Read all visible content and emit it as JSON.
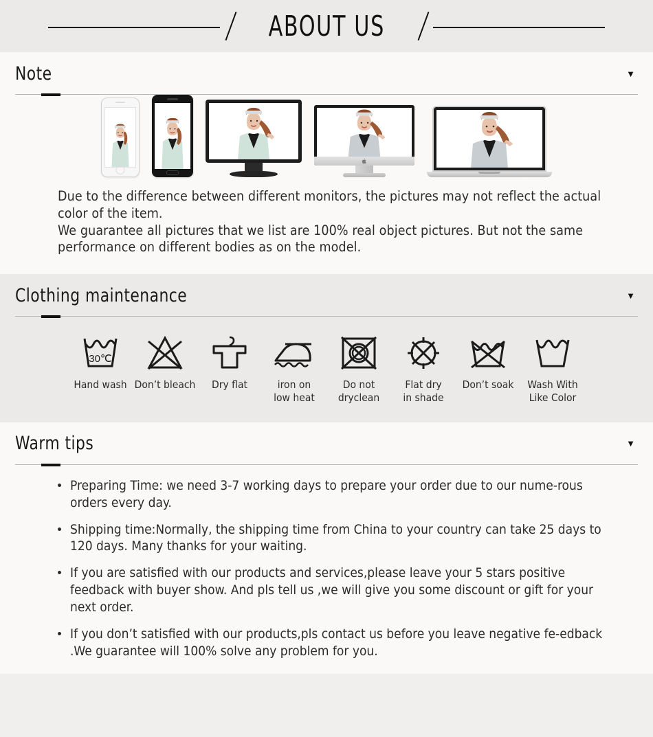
{
  "banner": {
    "title": "ABOUT US"
  },
  "sections": [
    {
      "id": "note",
      "title": "Note",
      "caret": "▼",
      "caret_icon_name": "chevron-down-icon",
      "devices": [
        {
          "name": "iphone-mockup",
          "tone": "mint"
        },
        {
          "name": "android-phone-mockup",
          "tone": "mint"
        },
        {
          "name": "desktop-monitor-mockup",
          "tone": "mint"
        },
        {
          "name": "imac-mockup",
          "tone": "gray"
        },
        {
          "name": "laptop-mockup",
          "tone": "gray"
        }
      ],
      "paragraphs": [
        "Due to the difference between different monitors, the pictures may not reflect the actual color of the item.",
        "We guarantee all pictures that we list are 100% real object pictures. But not the same performance on different bodies as on the model."
      ]
    },
    {
      "id": "clothing-maintenance",
      "title": "Clothing maintenance",
      "caret": "▼",
      "caret_icon_name": "chevron-down-icon",
      "care_items": [
        {
          "icon": "hand-wash-icon",
          "label": "Hand wash",
          "temperature": "30℃"
        },
        {
          "icon": "do-not-bleach-icon",
          "label": "Don’t bleach",
          "temperature": ""
        },
        {
          "icon": "dry-flat-icon",
          "label": "Dry flat",
          "temperature": ""
        },
        {
          "icon": "iron-low-heat-icon",
          "label": "iron on\nlow heat",
          "temperature": ""
        },
        {
          "icon": "do-not-dryclean-icon",
          "label": "Do not\ndryclean",
          "temperature": ""
        },
        {
          "icon": "flat-dry-shade-icon",
          "label": "Flat dry\nin shade",
          "temperature": ""
        },
        {
          "icon": "do-not-soak-icon",
          "label": "Don’t soak",
          "temperature": ""
        },
        {
          "icon": "wash-like-color-icon",
          "label": "Wash With\nLike Color",
          "temperature": ""
        }
      ]
    },
    {
      "id": "warm-tips",
      "title": "Warm tips",
      "caret": "▼",
      "caret_icon_name": "chevron-down-icon",
      "tips": [
        "Preparing Time: we need 3-7 working days to prepare your order due to our nume-rous orders every day.",
        "Shipping time:Normally, the shipping time from China to your country can take 25 days to 120 days. Many thanks for your waiting.",
        "If you are satisfied with our products and services,please leave your 5 stars positive feedback with buyer show. And pls tell us ,we will give you some discount or gift for your next order.",
        "If you don’t satisfied with our products,pls contact us before you leave negative fe-edback .We guarantee will 100% solve any problem for you."
      ]
    }
  ],
  "colors": {
    "banner_bg": "#eceae9",
    "band_light": "#faf9f8",
    "band_gray": "#eceae9",
    "page_bg": "#f0efed",
    "text": "#2b2b2b",
    "rule": "#b9b7b5",
    "accent": "#111111",
    "coat_mint": "#cfe3da",
    "coat_gray": "#c8cdd2"
  }
}
